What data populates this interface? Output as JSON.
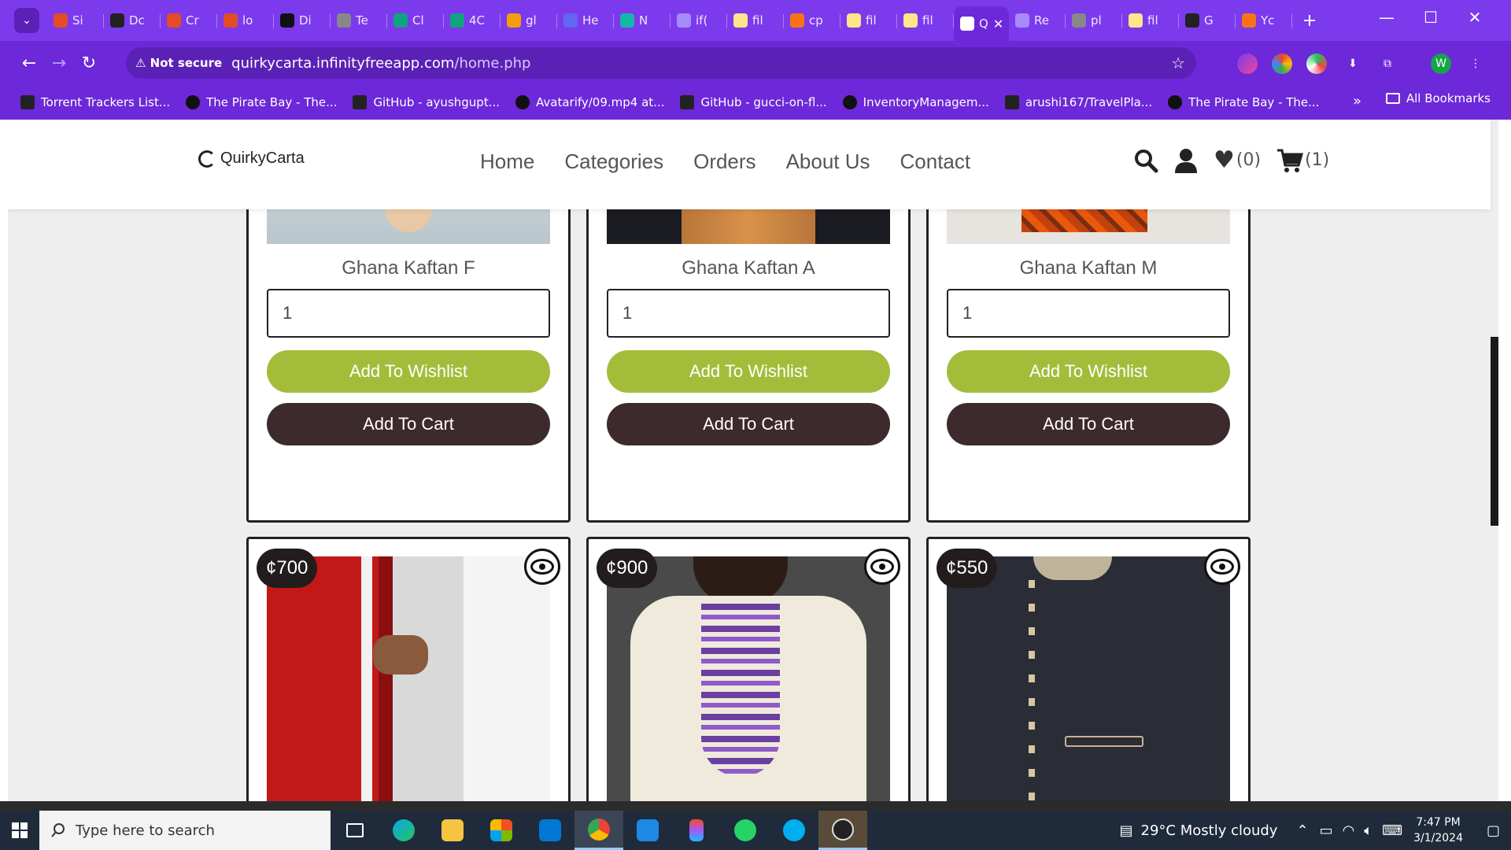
{
  "browser": {
    "tabs": [
      {
        "label": "Si",
        "color": "#e34c26"
      },
      {
        "label": "Dc",
        "color": "#222222"
      },
      {
        "label": "Cr",
        "color": "#e34c26"
      },
      {
        "label": "lo",
        "color": "#e34c26"
      },
      {
        "label": "Di",
        "color": "#111111"
      },
      {
        "label": "Te",
        "color": "#888888"
      },
      {
        "label": "Cl",
        "color": "#10a37f"
      },
      {
        "label": "4C",
        "color": "#10a37f"
      },
      {
        "label": "gl",
        "color": "#f59e0b"
      },
      {
        "label": "He",
        "color": "#6366f1"
      },
      {
        "label": "N",
        "color": "#14b8a6"
      },
      {
        "label": "if(",
        "color": "#a78bfa"
      },
      {
        "label": "fil",
        "color": "#fde68a"
      },
      {
        "label": "cp",
        "color": "#f97316"
      },
      {
        "label": "fil",
        "color": "#fde68a"
      },
      {
        "label": "fil",
        "color": "#fde68a"
      },
      {
        "label": "Q",
        "color": "#ffffff",
        "active": true
      },
      {
        "label": "Re",
        "color": "#a78bfa"
      },
      {
        "label": "pl",
        "color": "#888888"
      },
      {
        "label": "fil",
        "color": "#fde68a"
      },
      {
        "label": "G",
        "color": "#222222"
      },
      {
        "label": "Yc",
        "color": "#f97316"
      }
    ],
    "new_tab": "+",
    "nav": {
      "back": "←",
      "forward": "→",
      "reload": "↻"
    },
    "address": {
      "security": "Not secure",
      "domain": "quirkycarta.infinityfreeapp.com",
      "path": "/home.php",
      "star": "☆"
    },
    "profile_initial": "W",
    "bookmarks": [
      {
        "label": "Torrent Trackers List..."
      },
      {
        "label": "The Pirate Bay - The..."
      },
      {
        "label": "GitHub - ayushgupt..."
      },
      {
        "label": "Avatarify/09.mp4 at..."
      },
      {
        "label": "GitHub - gucci-on-fl..."
      },
      {
        "label": "InventoryManagem..."
      },
      {
        "label": "arushi167/TravelPla..."
      },
      {
        "label": "The Pirate Bay - The..."
      }
    ],
    "bookmarks_more": "»",
    "all_bookmarks": "All Bookmarks"
  },
  "site": {
    "brand": "QuirkyCarta",
    "nav": [
      "Home",
      "Categories",
      "Orders",
      "About Us",
      "Contact"
    ],
    "wishlist_count": "(0)",
    "cart_count": "(1)",
    "products_top": [
      {
        "name": "Ghana Kaftan F",
        "qty": "1",
        "wishlist_label": "Add To Wishlist",
        "cart_label": "Add To Cart"
      },
      {
        "name": "Ghana Kaftan A",
        "qty": "1",
        "wishlist_label": "Add To Wishlist",
        "cart_label": "Add To Cart"
      },
      {
        "name": "Ghana Kaftan M",
        "qty": "1",
        "wishlist_label": "Add To Wishlist",
        "cart_label": "Add To Cart"
      }
    ],
    "products_bottom": [
      {
        "price": "¢700"
      },
      {
        "price": "¢900"
      },
      {
        "price": "¢550"
      }
    ]
  },
  "taskbar": {
    "search_placeholder": "Type here to search",
    "weather": "29°C  Mostly cloudy",
    "time": "7:47 PM",
    "date": "3/1/2024"
  }
}
